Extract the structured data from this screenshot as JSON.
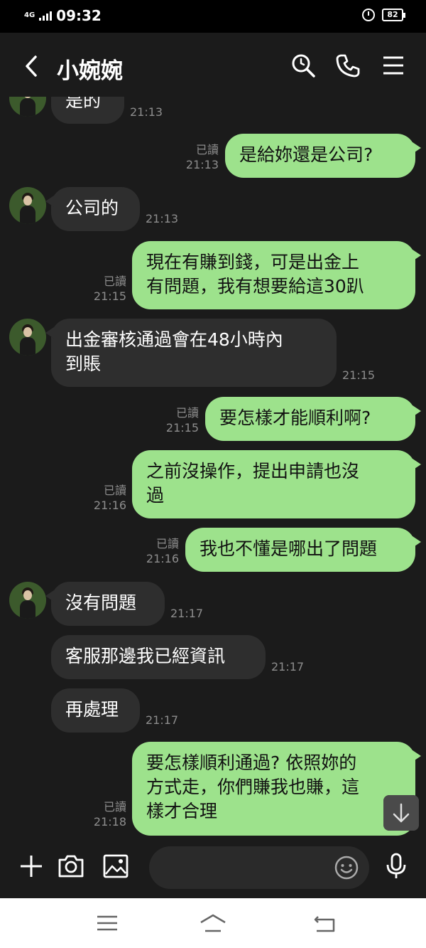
{
  "status_bar": {
    "network": "4G",
    "time": "09:32",
    "battery": "82"
  },
  "header": {
    "contact_name": "小婉婉"
  },
  "messages": [
    {
      "dir": "in",
      "text": "是的",
      "time": "21:13"
    },
    {
      "dir": "out",
      "text": "是給妳還是公司?",
      "read": "已讀",
      "time": "21:13"
    },
    {
      "dir": "in",
      "text": "公司的",
      "time": "21:13"
    },
    {
      "dir": "out",
      "text": "現在有賺到錢，可是出金上\n有問題，我有想要給這30趴",
      "read": "已讀",
      "time": "21:15"
    },
    {
      "dir": "in",
      "text": "出金審核通過會在48小時內\n到賬",
      "time": "21:15"
    },
    {
      "dir": "out",
      "text": "要怎樣才能順利啊?",
      "read": "已讀",
      "time": "21:15"
    },
    {
      "dir": "out",
      "text": "之前沒操作，提出申請也沒\n過",
      "read": "已讀",
      "time": "21:16"
    },
    {
      "dir": "out",
      "text": "我也不懂是哪出了問題",
      "read": "已讀",
      "time": "21:16"
    },
    {
      "dir": "in",
      "text": "沒有問題",
      "time": "21:17"
    },
    {
      "dir": "in",
      "text": "客服那邊我已經資訊",
      "time": "21:17"
    },
    {
      "dir": "in",
      "text": "再處理",
      "time": "21:17"
    },
    {
      "dir": "out",
      "text": "要怎樣順利通過? 依照妳的\n方式走，你們賺我也賺，這\n樣才合理",
      "read": "已讀",
      "time": "21:18"
    }
  ],
  "input": {
    "placeholder": ""
  },
  "icons": {
    "back": "chevron-left-icon",
    "search": "search-icon",
    "call": "phone-icon",
    "menu": "menu-icon",
    "add": "plus-icon",
    "camera": "camera-icon",
    "gallery": "image-icon",
    "emoji": "emoji-icon",
    "mic": "microphone-icon",
    "scroll": "arrow-down-icon"
  },
  "colors": {
    "outgoing_bubble": "#9de28c",
    "incoming_bubble": "#2e2e2e",
    "background": "#1b1b1b"
  }
}
